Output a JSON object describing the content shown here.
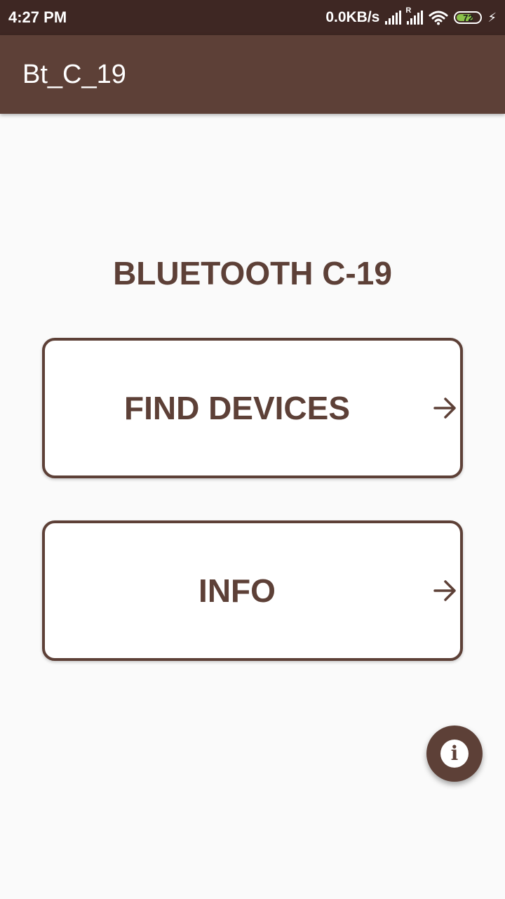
{
  "status_bar": {
    "time": "4:27 PM",
    "net_speed": "0.0KB/s",
    "roaming_mark": "R",
    "battery_level": "72",
    "battery_fraction": 0.72,
    "icons": [
      "signal-icon",
      "signal-roaming-icon",
      "wifi-icon",
      "battery-icon",
      "charging-bolt-icon"
    ]
  },
  "app_bar": {
    "title": "Bt_C_19"
  },
  "main": {
    "heading": "BLUETOOTH C-19",
    "buttons": [
      {
        "label": "FIND DEVICES",
        "icon": "arrow-right-icon"
      },
      {
        "label": "INFO",
        "icon": "arrow-right-icon"
      }
    ]
  },
  "fab": {
    "icon": "info-icon",
    "glyph": "i"
  },
  "colors": {
    "status_bar": "#3e2723",
    "primary": "#5d4037",
    "background": "#fafafa",
    "battery_fill": "#8bc34a"
  }
}
